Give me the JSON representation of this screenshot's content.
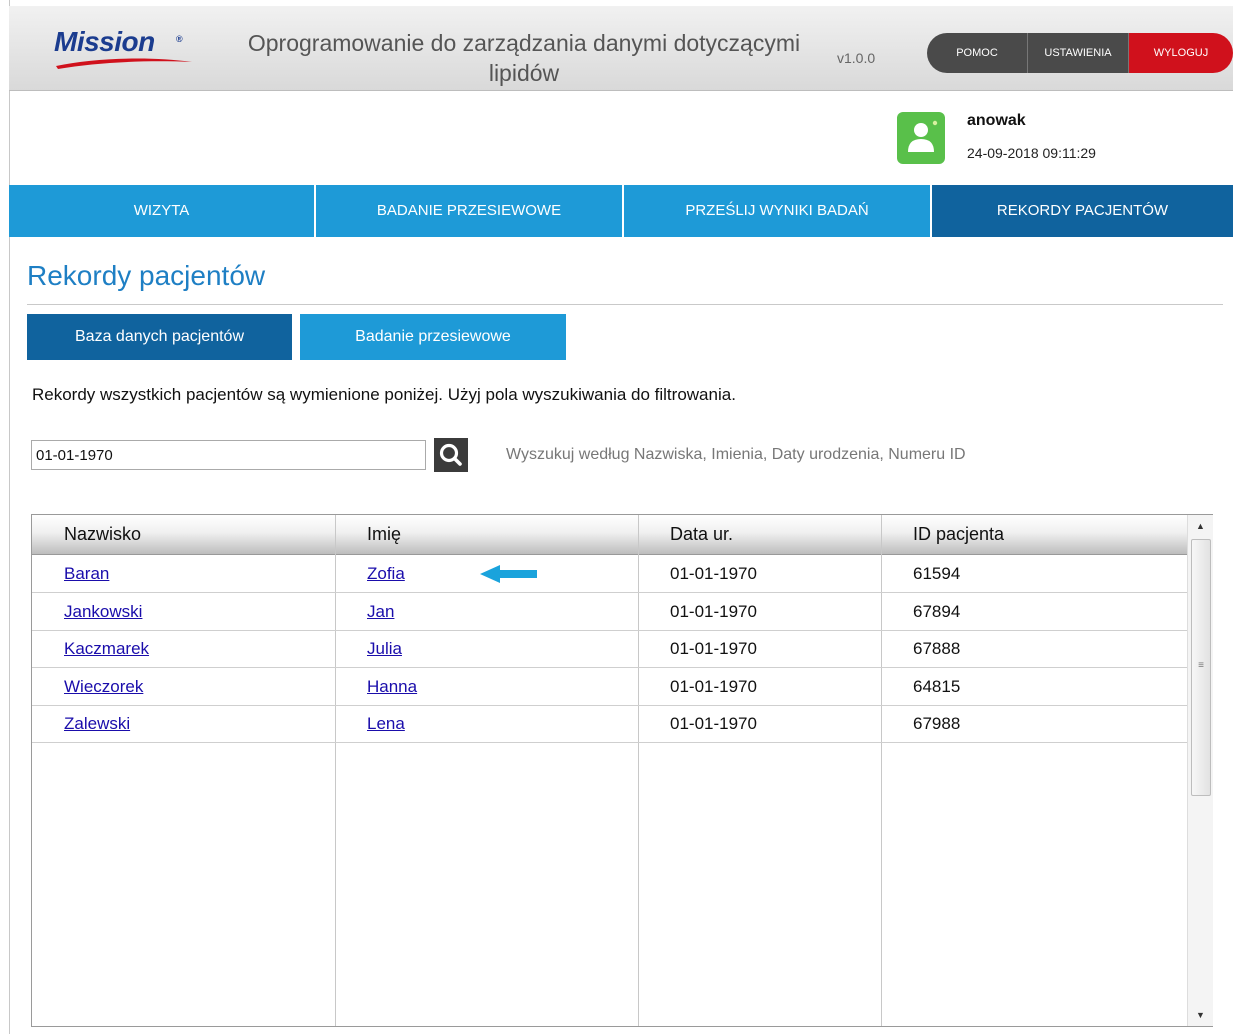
{
  "app": {
    "logo": "Mission",
    "title": "Oprogramowanie do zarządzania danymi dotyczącymi lipidów",
    "version": "v1.0.0"
  },
  "top_buttons": {
    "help": "POMOC",
    "settings": "USTAWIENIA",
    "logout": "WYLOGUJ"
  },
  "user": {
    "name": "anowak",
    "datetime": "24-09-2018 09:11:29",
    "icon": "user-avatar-icon"
  },
  "nav": {
    "tabs": [
      {
        "label": "WIZYTA"
      },
      {
        "label": "BADANIE PRZESIEWOWE"
      },
      {
        "label": "PRZEŚLIJ WYNIKI BADAŃ"
      },
      {
        "label": "REKORDY PACJENTÓW"
      }
    ]
  },
  "page": {
    "title": "Rekordy pacjentów",
    "sub_tabs": [
      {
        "label": "Baza danych pacjentów"
      },
      {
        "label": "Badanie przesiewowe"
      }
    ],
    "description": "Rekordy wszystkich pacjentów są wymienione poniżej. Użyj pola wyszukiwania do filtrowania."
  },
  "search": {
    "value": "01-01-1970",
    "hint": "Wyszukuj według Nazwiska, Imienia, Daty urodzenia, Numeru ID"
  },
  "table": {
    "headers": [
      "Nazwisko",
      "Imię",
      "Data ur.",
      "ID pacjenta"
    ],
    "rows": [
      {
        "surname": "Baran",
        "name": "Zofia",
        "dob": "01-01-1970",
        "id": "61594"
      },
      {
        "surname": "Jankowski",
        "name": "Jan",
        "dob": "01-01-1970",
        "id": "67894"
      },
      {
        "surname": "Kaczmarek",
        "name": "Julia",
        "dob": "01-01-1970",
        "id": "67888"
      },
      {
        "surname": "Wieczorek",
        "name": "Hanna",
        "dob": "01-01-1970",
        "id": "64815"
      },
      {
        "surname": "Zalewski",
        "name": "Lena",
        "dob": "01-01-1970",
        "id": "67988"
      }
    ]
  },
  "colors": {
    "nav_blue": "#1e9ad7",
    "nav_active": "#10639e",
    "logout_red": "#d0111c",
    "title_blue": "#1e7fc4",
    "arrow_blue": "#1aa3dc"
  }
}
